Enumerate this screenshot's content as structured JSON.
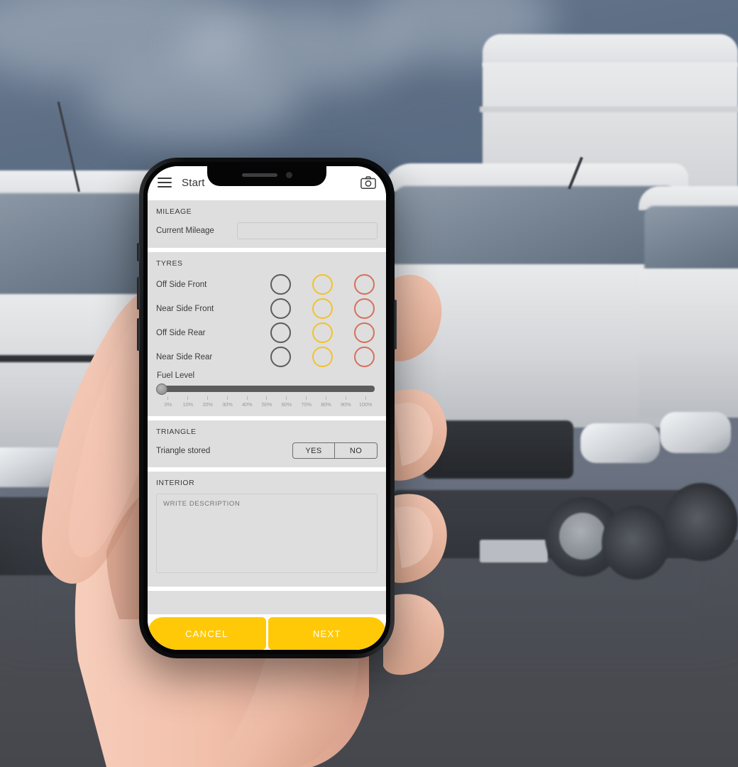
{
  "background": {
    "scene_description": "blurred-parked-white-vans-on-tarmac",
    "sky_color": "#5d6e85",
    "ground_color": "#4b4d53"
  },
  "device": {
    "name": "smartphone-mockup",
    "held_by": "left-hand"
  },
  "app": {
    "appbar": {
      "menu_icon": "hamburger-menu-icon",
      "title": "Start",
      "camera_icon": "camera-icon"
    },
    "sections": {
      "mileage": {
        "title": "MILEAGE",
        "label": "Current Mileage",
        "value": "",
        "placeholder": ""
      },
      "tyres": {
        "title": "TYRES",
        "rows": [
          {
            "label": "Off Side Front"
          },
          {
            "label": "Near Side Front"
          },
          {
            "label": "Off Side Rear"
          },
          {
            "label": "Near Side Rear"
          }
        ],
        "option_colors": {
          "ok": "#5c5c5c",
          "warn": "#f3c12c",
          "bad": "#d4705c"
        },
        "option_names": [
          "ok",
          "warn",
          "bad"
        ]
      },
      "fuel": {
        "label": "Fuel Level",
        "value": 0,
        "min": 0,
        "max": 100,
        "ticks": [
          "0%",
          "10%",
          "20%",
          "30%",
          "40%",
          "50%",
          "60%",
          "70%",
          "80%",
          "90%",
          "100%"
        ]
      },
      "triangle": {
        "title": "TRIANGLE",
        "label": "Triangle stored",
        "yes_label": "YES",
        "no_label": "NO",
        "selected": ""
      },
      "interior": {
        "title": "INTERIOR",
        "value": "",
        "placeholder": "WRITE DESCRIPTION"
      }
    },
    "footer": {
      "cancel_label": "CANCEL",
      "next_label": "NEXT",
      "accent_color": "#FFC907"
    }
  }
}
